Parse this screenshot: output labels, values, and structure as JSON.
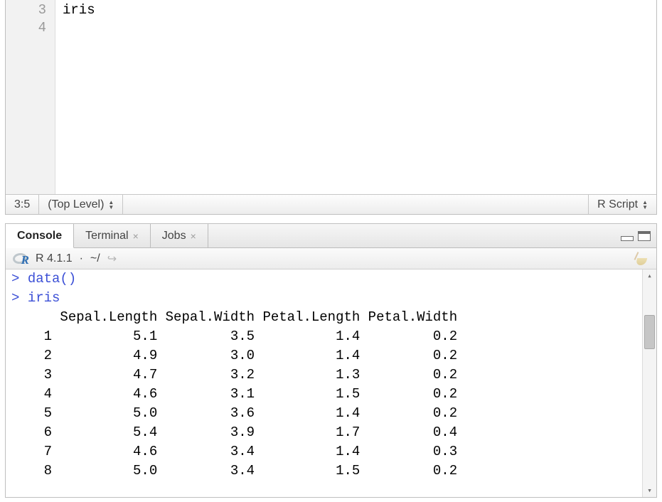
{
  "editor": {
    "lines": [
      {
        "num": "3",
        "text": "iris"
      },
      {
        "num": "4",
        "text": ""
      }
    ],
    "status": {
      "cursor": "3:5",
      "scope": "(Top Level)",
      "filetype": "R Script"
    }
  },
  "tabs": {
    "console": "Console",
    "terminal": "Terminal",
    "jobs": "Jobs"
  },
  "subbar": {
    "version": "R 4.1.1",
    "sep": "·",
    "path": "~/"
  },
  "console": {
    "lines": [
      {
        "prompt": ">",
        "cmd": "data()"
      },
      {
        "prompt": ">",
        "cmd": "iris"
      }
    ],
    "table": {
      "headers": [
        "Sepal.Length",
        "Sepal.Width",
        "Petal.Length",
        "Petal.Width"
      ],
      "rows": [
        {
          "n": "1",
          "v": [
            "5.1",
            "3.5",
            "1.4",
            "0.2"
          ]
        },
        {
          "n": "2",
          "v": [
            "4.9",
            "3.0",
            "1.4",
            "0.2"
          ]
        },
        {
          "n": "3",
          "v": [
            "4.7",
            "3.2",
            "1.3",
            "0.2"
          ]
        },
        {
          "n": "4",
          "v": [
            "4.6",
            "3.1",
            "1.5",
            "0.2"
          ]
        },
        {
          "n": "5",
          "v": [
            "5.0",
            "3.6",
            "1.4",
            "0.2"
          ]
        },
        {
          "n": "6",
          "v": [
            "5.4",
            "3.9",
            "1.7",
            "0.4"
          ]
        },
        {
          "n": "7",
          "v": [
            "4.6",
            "3.4",
            "1.4",
            "0.3"
          ]
        },
        {
          "n": "8",
          "v": [
            "5.0",
            "3.4",
            "1.5",
            "0.2"
          ]
        }
      ]
    }
  }
}
